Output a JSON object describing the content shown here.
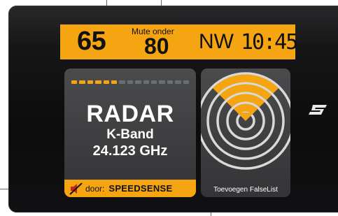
{
  "status_bar": {
    "current_speed": "65",
    "mute_label": "Mute onder",
    "mute_speed": "80",
    "heading": "NW",
    "clock": "10:45"
  },
  "radar_panel": {
    "signal_strength": 0.4,
    "signal_segments_total": 15,
    "signal_segments_on": 6,
    "title": "RADAR",
    "band": "K-Band",
    "frequency": "24.123 GHz",
    "mute_icon": "speaker-muted-icon",
    "door_label": "door:",
    "door_brand": "SPEEDSENSE"
  },
  "graphic_panel": {
    "icon": "radar-signal-icon",
    "action_label": "Toevoegen FalseList"
  },
  "brand": {
    "logo": "speedsense-logo-icon"
  },
  "colors": {
    "accent": "#f5a512",
    "panel": "#3f4042",
    "bezel": "#141416",
    "text_light": "#ffffff",
    "text_dark": "#111111"
  }
}
